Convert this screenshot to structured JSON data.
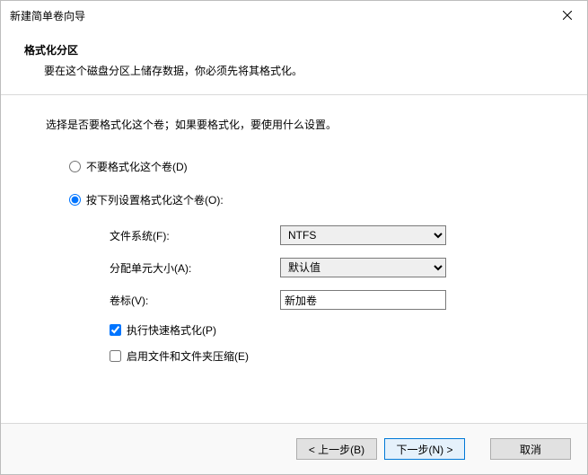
{
  "window": {
    "title": "新建简单卷向导"
  },
  "header": {
    "title": "格式化分区",
    "sub": "要在这个磁盘分区上储存数据，你必须先将其格式化。"
  },
  "content": {
    "instruction": "选择是否要格式化这个卷；如果要格式化，要使用什么设置。",
    "radio_no_format": "不要格式化这个卷(D)",
    "radio_format": "按下列设置格式化这个卷(O):",
    "fields": {
      "filesystem_label": "文件系统(F):",
      "filesystem_value": "NTFS",
      "alloc_label": "分配单元大小(A):",
      "alloc_value": "默认值",
      "volume_label_label": "卷标(V):",
      "volume_label_value": "新加卷"
    },
    "checks": {
      "quick_format": "执行快速格式化(P)",
      "quick_format_checked": true,
      "compression": "启用文件和文件夹压缩(E)",
      "compression_checked": false
    }
  },
  "footer": {
    "back": "< 上一步(B)",
    "next": "下一步(N) >",
    "cancel": "取消"
  }
}
